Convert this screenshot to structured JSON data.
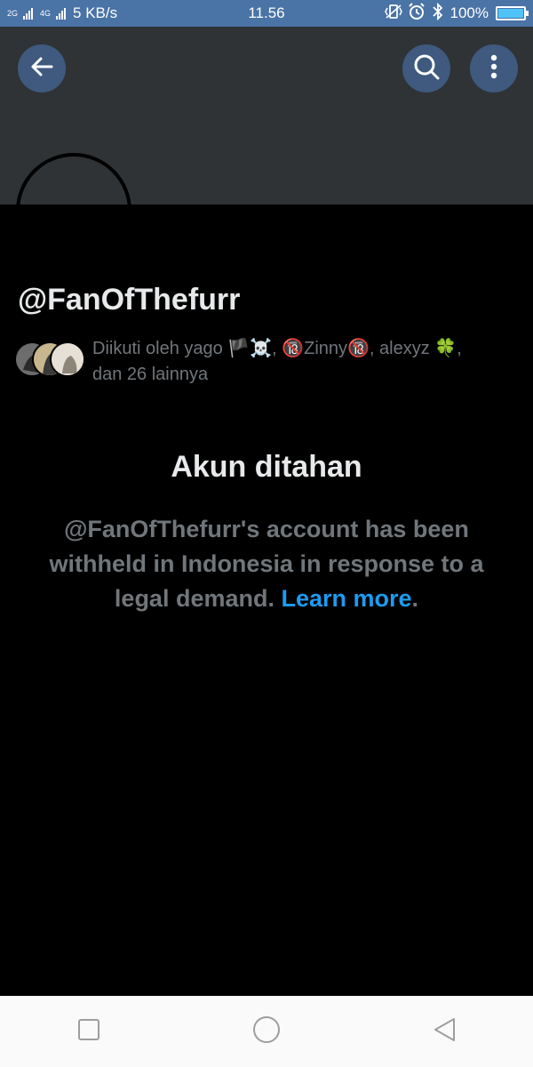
{
  "status_bar": {
    "network_1": "2G",
    "network_2": "4G",
    "speed": "5 KB/s",
    "time": "11.56",
    "battery": "100%",
    "battery_level": 1.0,
    "accent": "#4a73a6"
  },
  "header": {
    "back_icon": "arrow-left-icon",
    "search_icon": "search-icon",
    "more_icon": "more-vertical-icon"
  },
  "profile": {
    "handle": "@FanOfThefurr",
    "followed_by": "Diikuti oleh yago 🏴☠️, 🔞Zinny🔞, alexyz 🍀,",
    "followed_by_more": "dan 26 lainnya"
  },
  "notice": {
    "title": "Akun ditahan",
    "body": "@FanOfThefurr's account has been withheld in Indonesia in response to a legal demand. ",
    "link": "Learn more",
    "period": "."
  },
  "colors": {
    "background": "#000000",
    "banner": "#2f3336",
    "link": "#1d9bf0",
    "muted_text": "#71767b",
    "primary_text": "#e7e9ea"
  }
}
